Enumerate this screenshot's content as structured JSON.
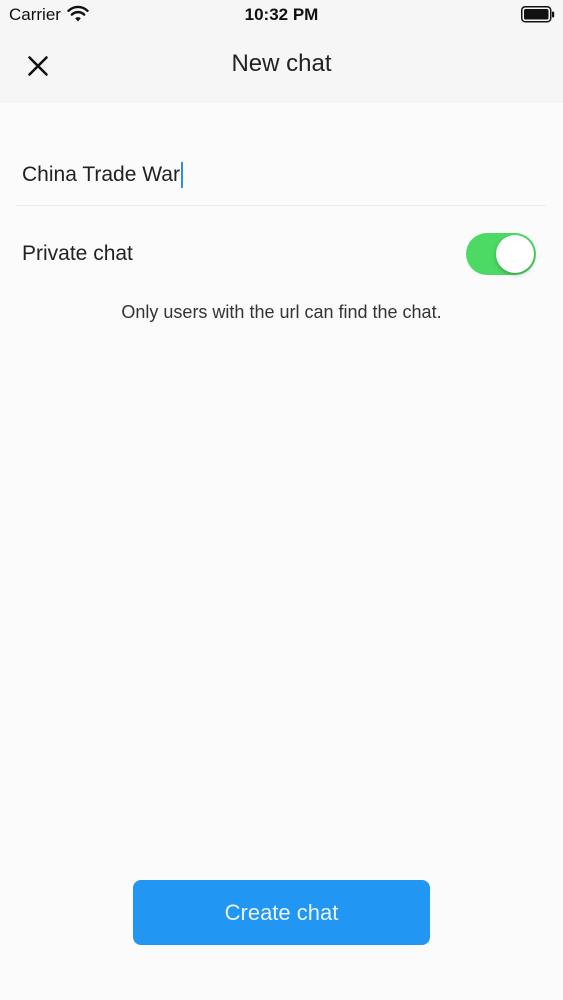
{
  "status_bar": {
    "carrier": "Carrier",
    "time": "10:32 PM",
    "wifi_icon": "wifi-icon",
    "battery_icon": "battery-icon"
  },
  "nav": {
    "title": "New chat",
    "close_icon": "close-icon"
  },
  "form": {
    "name_field_value": "China Trade War",
    "private_chat_label": "Private chat",
    "private_chat_enabled": true,
    "hint": "Only users with the url can find the chat."
  },
  "actions": {
    "create_label": "Create chat"
  },
  "colors": {
    "accent": "#2196f3",
    "toggle_on": "#4cd964",
    "caret": "#2f8fde"
  }
}
